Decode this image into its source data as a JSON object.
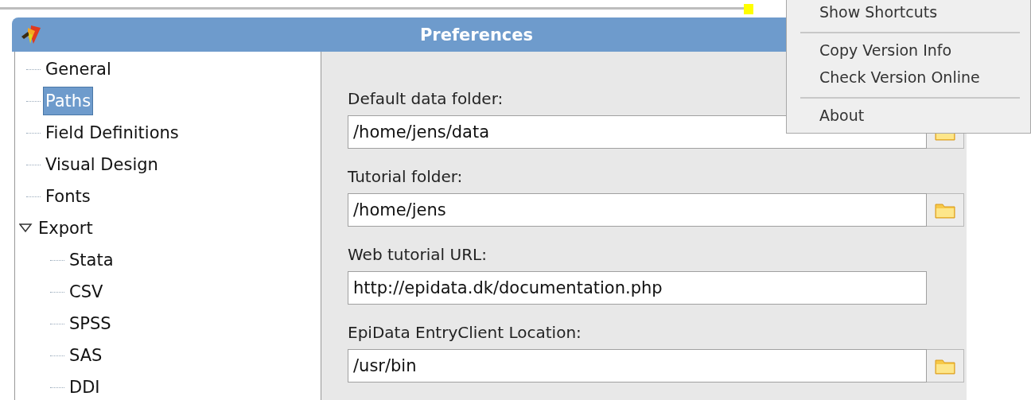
{
  "window": {
    "title": "Preferences"
  },
  "tree": [
    {
      "label": "General",
      "selected": false
    },
    {
      "label": "Paths",
      "selected": true
    },
    {
      "label": "Field Definitions",
      "selected": false
    },
    {
      "label": "Visual Design",
      "selected": false
    },
    {
      "label": "Fonts",
      "selected": false
    },
    {
      "label": "Export",
      "selected": false,
      "expanded": true,
      "children": [
        {
          "label": "Stata",
          "selected": false
        },
        {
          "label": "CSV",
          "selected": false
        },
        {
          "label": "SPSS",
          "selected": false
        },
        {
          "label": "SAS",
          "selected": false
        },
        {
          "label": "DDI",
          "selected": false
        }
      ]
    }
  ],
  "fields": [
    {
      "label": "Default data folder:",
      "value": "/home/jens/data",
      "kind": "folder"
    },
    {
      "label": "Tutorial folder:",
      "value": "/home/jens",
      "kind": "folder"
    },
    {
      "label": "Web tutorial URL:",
      "value": "http://epidata.dk/documentation.php",
      "kind": "text"
    },
    {
      "label": "EpiData EntryClient Location:",
      "value": "/usr/bin",
      "kind": "folder"
    }
  ],
  "menu": [
    {
      "kind": "item",
      "label": "Show Shortcuts"
    },
    {
      "kind": "separator"
    },
    {
      "kind": "item",
      "label": "Copy Version Info"
    },
    {
      "kind": "item",
      "label": "Check Version Online"
    },
    {
      "kind": "separator"
    },
    {
      "kind": "item",
      "label": "About"
    }
  ]
}
